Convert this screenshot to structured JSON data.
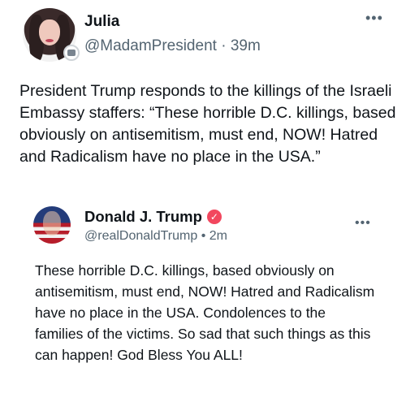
{
  "post": {
    "author_name": "Julia",
    "handle": "@MadamPresident",
    "separator": "·",
    "time": "39m",
    "more_icon": "more-horizontal-icon",
    "text": "President Trump responds to the killings of the Israeli Embassy staffers: “These horrible D.C. killings, based obviously on antisemitism, must end, NOW! Hatred and Radicalism have no place in the USA.”"
  },
  "quoted_post": {
    "author_name": "Donald J. Trump",
    "verified_icon": "verified-badge-icon",
    "verified_color": "#f2475e",
    "handle": "@realDonaldTrump",
    "separator": "•",
    "time": "2m",
    "more_icon": "more-horizontal-icon",
    "text": "These horrible D.C. killings, based obviously on antisemitism, must end, NOW! Hatred and Radicalism have no place in the USA. Condolences to the families of the victims. So sad that such things as this can happen! God Bless You ALL!"
  },
  "colors": {
    "text_primary": "#0f1419",
    "text_secondary": "#536471",
    "background": "#ffffff"
  }
}
